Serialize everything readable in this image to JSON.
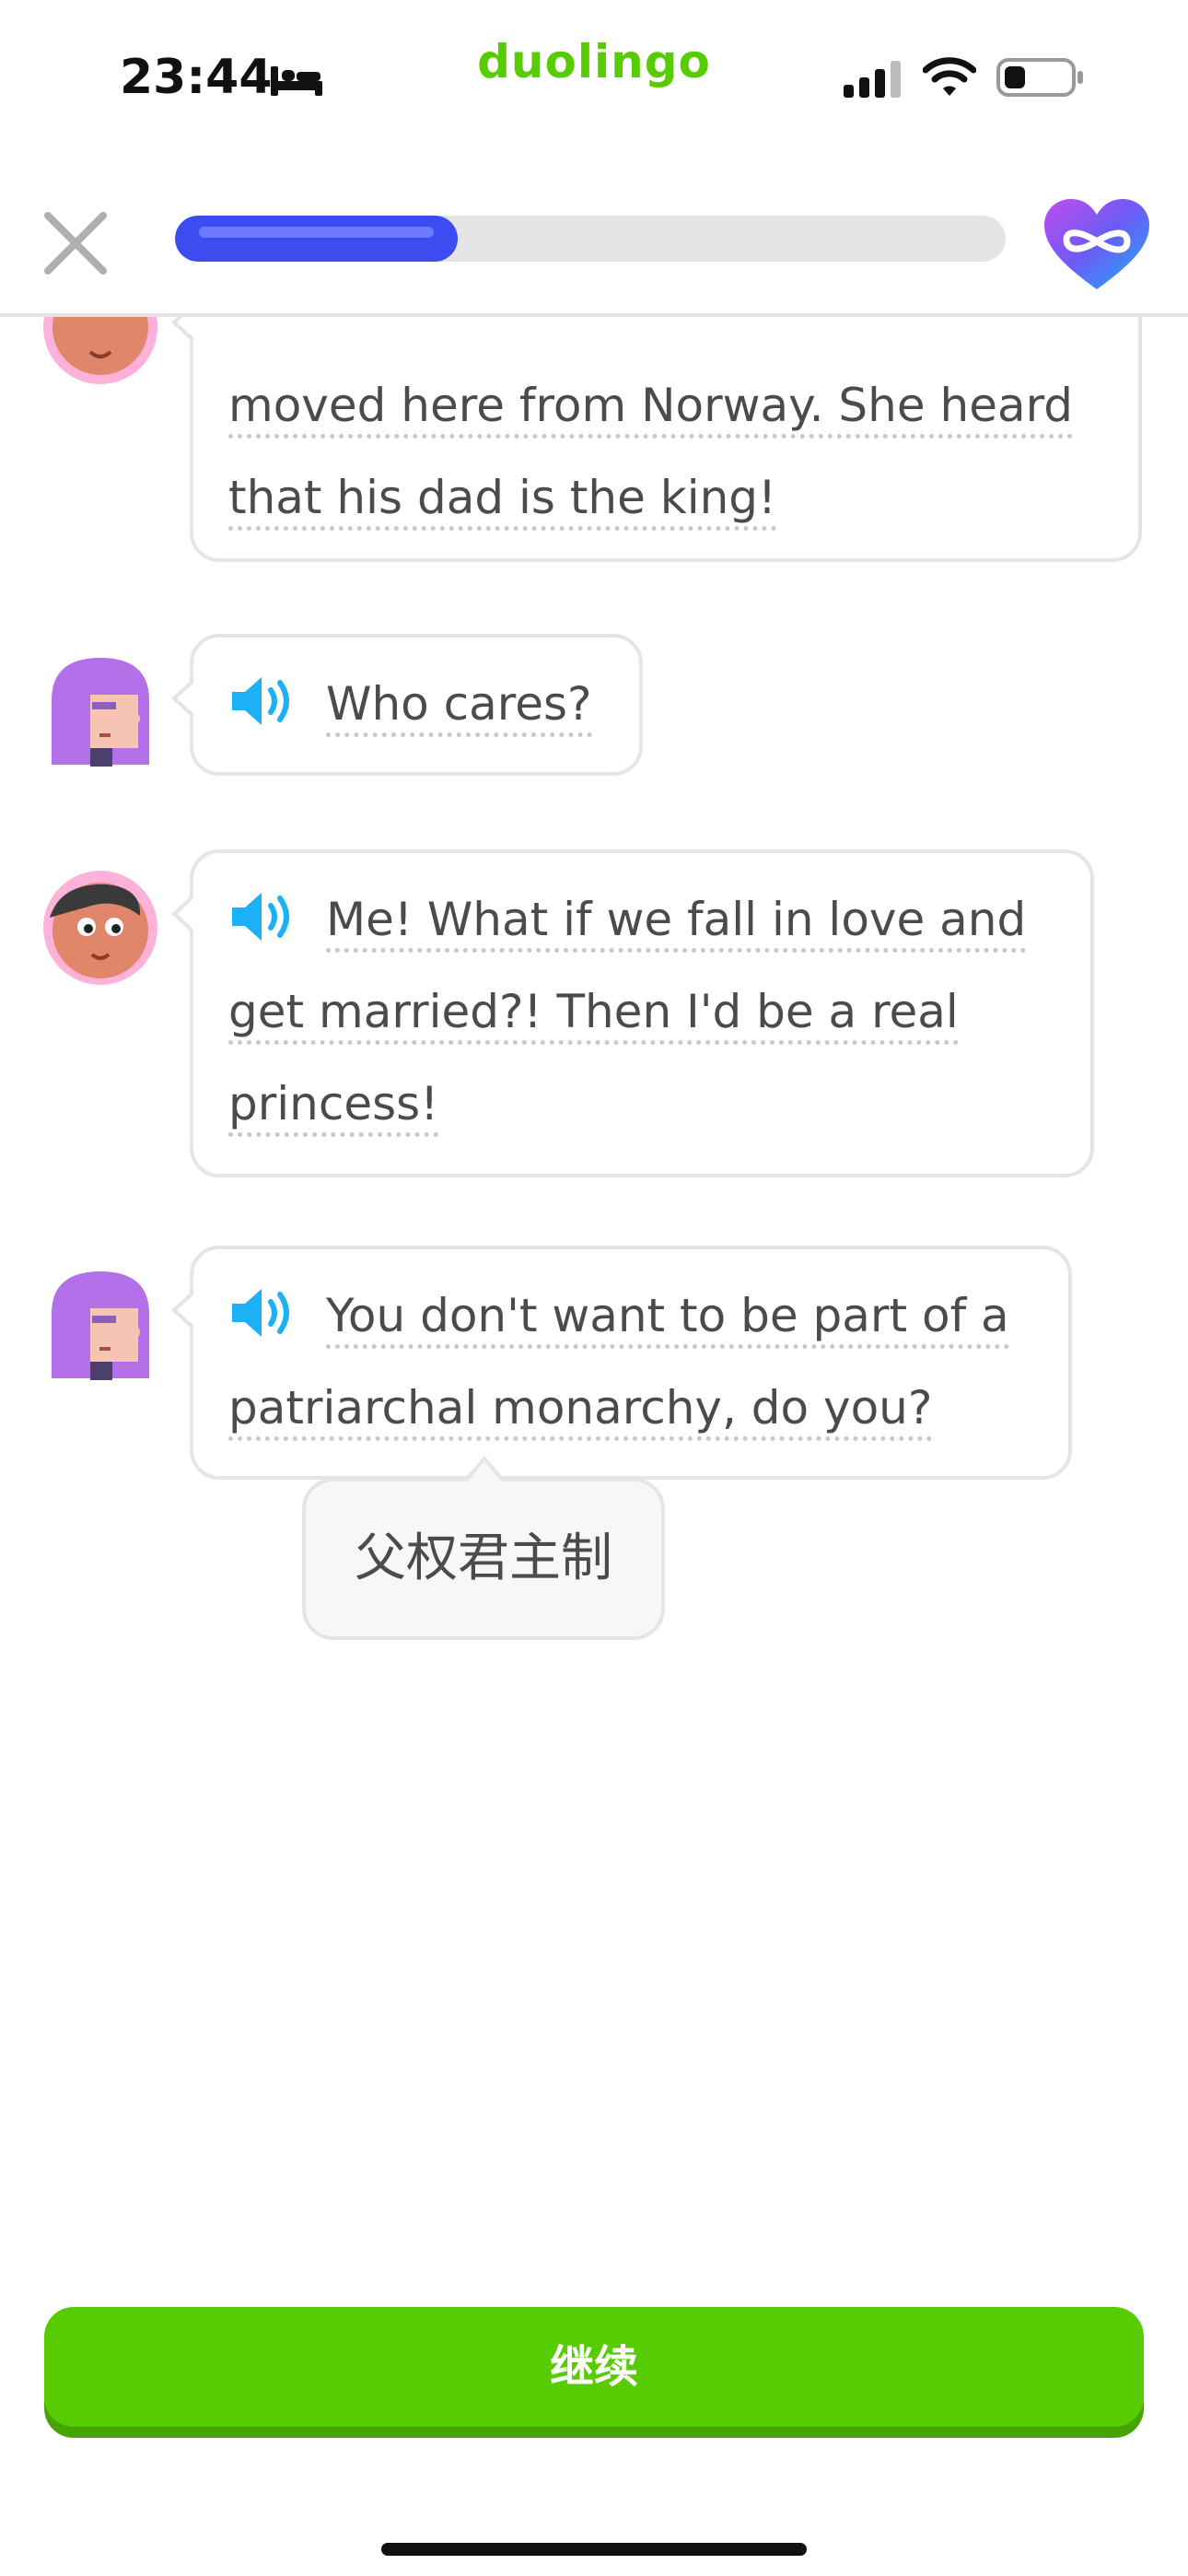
{
  "status_bar": {
    "time": "23:44",
    "brand": "duolingo"
  },
  "lesson": {
    "progress": 0.34
  },
  "messages": [
    {
      "speaker": "boy",
      "lines": [
        "moved here from Norway. She heard",
        "that his dad is the king!"
      ]
    },
    {
      "speaker": "girl",
      "text": "Who cares?"
    },
    {
      "speaker": "boy",
      "lines": [
        "Me! What if we fall in love and",
        "get married?! Then I'd be a real",
        "princess!"
      ]
    },
    {
      "speaker": "girl",
      "lines": [
        "You don't want to be part of a",
        "patriarchal monarchy, do you?"
      ]
    }
  ],
  "tooltip": {
    "translation": "父权君主制"
  },
  "footer": {
    "continue_label": "继续"
  },
  "colors": {
    "accent": "#58cc02",
    "progress": "#3c4cf0",
    "speaker": "#1cb0f6"
  }
}
